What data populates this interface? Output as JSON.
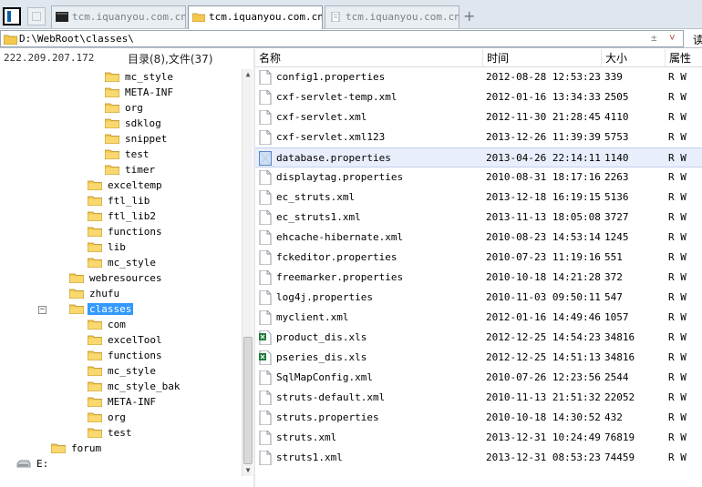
{
  "tabs": [
    {
      "label": "tcm.iquanyou.com.cn",
      "active": false,
      "icon": "terminal-icon"
    },
    {
      "label": "tcm.iquanyou.com.cn",
      "active": true,
      "icon": "folder-icon"
    },
    {
      "label": "tcm.iquanyou.com.cn",
      "active": false,
      "icon": "document-icon"
    }
  ],
  "path": {
    "value": "D:\\WebRoot\\classes\\",
    "right_symbol": "±",
    "dropdown": "˅",
    "go_label": "读"
  },
  "left": {
    "ip": "222.209.207.172",
    "counts": "目录(8),文件(37)"
  },
  "tree": [
    {
      "label": "mc_style",
      "depth": 4
    },
    {
      "label": "META-INF",
      "depth": 4
    },
    {
      "label": "org",
      "depth": 4
    },
    {
      "label": "sdklog",
      "depth": 4
    },
    {
      "label": "snippet",
      "depth": 4
    },
    {
      "label": "test",
      "depth": 4
    },
    {
      "label": "timer",
      "depth": 4
    },
    {
      "label": "exceltemp",
      "depth": 3
    },
    {
      "label": "ftl_lib",
      "depth": 3
    },
    {
      "label": "ftl_lib2",
      "depth": 3
    },
    {
      "label": "functions",
      "depth": 3
    },
    {
      "label": "lib",
      "depth": 3
    },
    {
      "label": "mc_style",
      "depth": 3
    },
    {
      "label": "webresources",
      "depth": 2
    },
    {
      "label": "zhufu",
      "depth": 2
    },
    {
      "label": "classes",
      "depth": 2,
      "selected": true,
      "expanded": true
    },
    {
      "label": "com",
      "depth": 3
    },
    {
      "label": "excelTool",
      "depth": 3
    },
    {
      "label": "functions",
      "depth": 3
    },
    {
      "label": "mc_style",
      "depth": 3
    },
    {
      "label": "mc_style_bak",
      "depth": 3
    },
    {
      "label": "META-INF",
      "depth": 3
    },
    {
      "label": "org",
      "depth": 3
    },
    {
      "label": "test",
      "depth": 3
    },
    {
      "label": "forum",
      "depth": 1
    },
    {
      "label": "E:",
      "depth": 0,
      "drive": true
    }
  ],
  "columns": {
    "name": "名称",
    "time": "时间",
    "size": "大小",
    "attr": "属性"
  },
  "files": [
    {
      "name": "config1.properties",
      "time": "2012-08-28 12:53:23",
      "size": "339",
      "attr": "R W",
      "icon": "file-icon"
    },
    {
      "name": "cxf-servlet-temp.xml",
      "time": "2012-01-16 13:34:33",
      "size": "2505",
      "attr": "R W",
      "icon": "file-icon"
    },
    {
      "name": "cxf-servlet.xml",
      "time": "2012-11-30 21:28:45",
      "size": "4110",
      "attr": "R W",
      "icon": "file-icon"
    },
    {
      "name": "cxf-servlet.xml123",
      "time": "2013-12-26 11:39:39",
      "size": "5753",
      "attr": "R W",
      "icon": "file-icon"
    },
    {
      "name": "database.properties",
      "time": "2013-04-26 22:14:11",
      "size": "1140",
      "attr": "R W",
      "icon": "selected-file-icon",
      "selected": true
    },
    {
      "name": "displaytag.properties",
      "time": "2010-08-31 18:17:16",
      "size": "2263",
      "attr": "R W",
      "icon": "file-icon"
    },
    {
      "name": "ec_struts.xml",
      "time": "2013-12-18 16:19:15",
      "size": "5136",
      "attr": "R W",
      "icon": "file-icon"
    },
    {
      "name": "ec_struts1.xml",
      "time": "2013-11-13 18:05:08",
      "size": "3727",
      "attr": "R W",
      "icon": "file-icon"
    },
    {
      "name": "ehcache-hibernate.xml",
      "time": "2010-08-23 14:53:14",
      "size": "1245",
      "attr": "R W",
      "icon": "file-icon"
    },
    {
      "name": "fckeditor.properties",
      "time": "2010-07-23 11:19:16",
      "size": "551",
      "attr": "R W",
      "icon": "file-icon"
    },
    {
      "name": "freemarker.properties",
      "time": "2010-10-18 14:21:28",
      "size": "372",
      "attr": "R W",
      "icon": "file-icon"
    },
    {
      "name": "log4j.properties",
      "time": "2010-11-03 09:50:11",
      "size": "547",
      "attr": "R W",
      "icon": "file-icon"
    },
    {
      "name": "myclient.xml",
      "time": "2012-01-16 14:49:46",
      "size": "1057",
      "attr": "R W",
      "icon": "file-icon"
    },
    {
      "name": "product_dis.xls",
      "time": "2012-12-25 14:54:23",
      "size": "34816",
      "attr": "R W",
      "icon": "excel-icon"
    },
    {
      "name": "pseries_dis.xls",
      "time": "2012-12-25 14:51:13",
      "size": "34816",
      "attr": "R W",
      "icon": "excel-icon"
    },
    {
      "name": "SqlMapConfig.xml",
      "time": "2010-07-26 12:23:56",
      "size": "2544",
      "attr": "R W",
      "icon": "file-icon"
    },
    {
      "name": "struts-default.xml",
      "time": "2010-11-13 21:51:32",
      "size": "22052",
      "attr": "R W",
      "icon": "file-icon"
    },
    {
      "name": "struts.properties",
      "time": "2010-10-18 14:30:52",
      "size": "432",
      "attr": "R W",
      "icon": "file-icon"
    },
    {
      "name": "struts.xml",
      "time": "2013-12-31 10:24:49",
      "size": "76819",
      "attr": "R W",
      "icon": "file-icon"
    },
    {
      "name": "struts1.xml",
      "time": "2013-12-31 08:53:23",
      "size": "74459",
      "attr": "R W",
      "icon": "file-icon"
    }
  ],
  "colors": {
    "selection": "#3399ff",
    "row_selected": "#e8eefb",
    "folder": "#f4c84d"
  }
}
